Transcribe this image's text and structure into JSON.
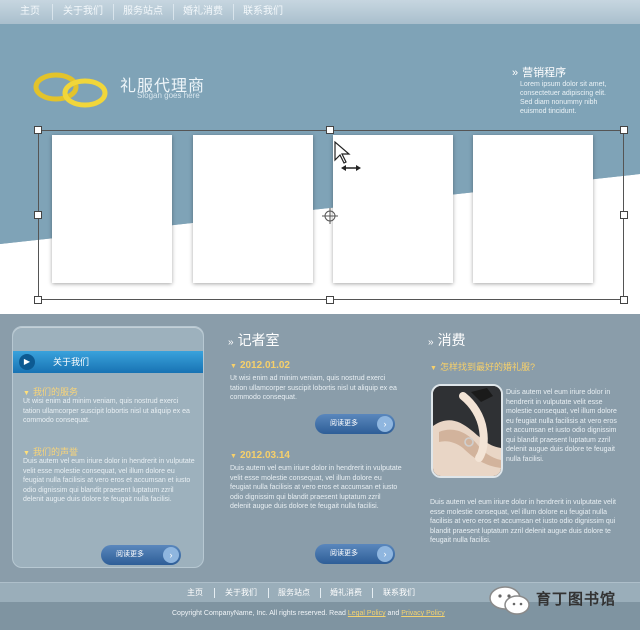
{
  "top_nav": [
    "主页",
    "关于我们",
    "服务站点",
    "婚礼消费",
    "联系我们"
  ],
  "header": {
    "logo_title": "礼服代理商",
    "logo_slogan": "Slogan goes here",
    "headline_title": "营销程序",
    "headline_text": "Lorem ipsum dolor sit amet, consectetuer adipiscing elit. Sed diam nonummy nibh euismod tincidunt."
  },
  "left_panel": {
    "bar_label": "关于我们",
    "item1_title": "我们的服务",
    "item1_text": "Ut wisi enim ad minim veniam, quis nostrud exerci tation ullamcorper suscipit lobortis nisl ut aliquip ex ea commodo consequat.",
    "item2_title": "我们的声誉",
    "item2_text": "Duis autem vel eum iriure dolor in hendrerit in vulputate velit esse molestie consequat, vel illum dolore eu feugiat nulla facilisis at vero eros et accumsan et iusto odio dignissim qui blandit praesent luptatum zzril delenit augue duis dolore te feugait nulla facilisi.",
    "more_label": "阅读更多"
  },
  "middle": {
    "section_title": "记者室",
    "news1_date": "2012.01.02",
    "news1_text": "Ut wisi enim ad minim veniam, quis nostrud exerci tation ullamcorper suscipit lobortis nisl ut aliquip ex ea commodo consequat.",
    "news2_date": "2012.03.14",
    "news2_text": "Duis autem vel eum iriure dolor in hendrerit in vulputate velit esse molestie consequat, vel illum dolore eu feugiat nulla facilisis at vero eros et accumsan et iusto odio dignissim qui blandit praesent luptatum zzril delenit augue duis dolore te feugait nulla facilisi.",
    "more_label": "阅读更多"
  },
  "right": {
    "section_title": "消费",
    "question": "怎样找到最好的婚礼服?",
    "text1": "Duis autem vel eum iriure dolor in hendrerit in vulputate velit esse molestie consequat, vel illum dolore eu feugiat nulla facilisis at vero eros et accumsan et iusto odio dignissim qui blandit praesent luptatum zzril delenit augue duis dolore te feugait nulla facilisi.",
    "text2": "Duis autem vel eum iriure dolor in hendrerit in vulputate velit esse molestie consequat, vel illum dolore eu feugiat nulla facilisis at vero eros et accumsan et iusto odio dignissim qui blandit praesent luptatum zzril delenit augue duis dolore te feugait nulla facilisi."
  },
  "footer_nav": [
    "主页",
    "关于我们",
    "服务站点",
    "婚礼消费",
    "联系我们"
  ],
  "copyright": {
    "prefix": "Copyright CompanyName, Inc. All rights reserved. Read ",
    "legal": "Legal Policy",
    "and": " and ",
    "privacy": "Privacy Policy"
  },
  "watermark": "育丁图书馆",
  "colors": {
    "accent_blue": "#1873b3",
    "gold": "#f7d06a",
    "header_blue": "#7fa3b7"
  }
}
